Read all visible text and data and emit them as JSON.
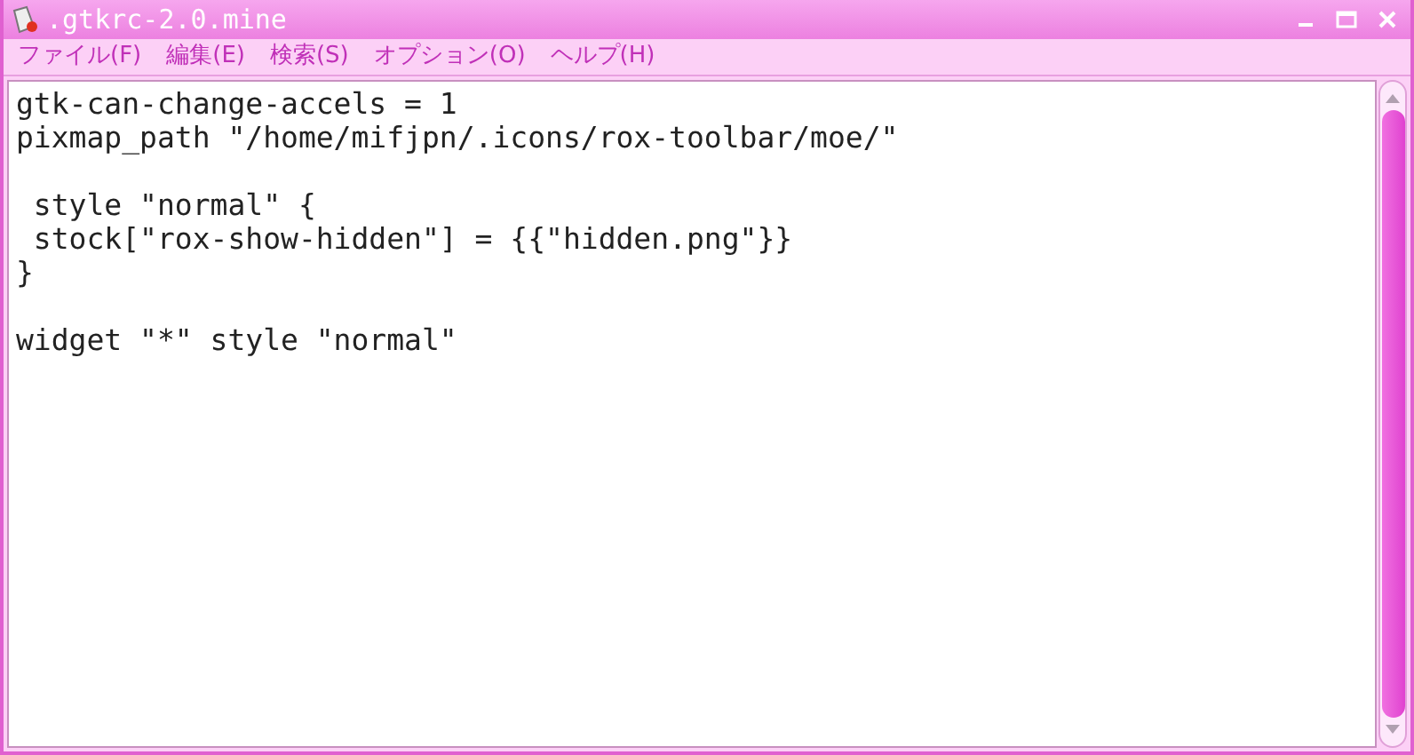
{
  "window": {
    "title": ".gtkrc-2.0.mine"
  },
  "menu": [
    "ファイル(F)",
    "編集(E)",
    "検索(S)",
    "オプション(O)",
    "ヘルプ(H)"
  ],
  "editor": {
    "lines": [
      {
        "kind": "text",
        "text": "gtk-can-change-accels = 1"
      },
      {
        "kind": "text",
        "text": "pixmap_path \"/home/mifjpn/.icons/rox-toolbar/moe/\""
      },
      {
        "kind": "blank"
      },
      {
        "kind": "text",
        "text": " style \"normal\" {"
      },
      {
        "kind": "text",
        "text": " stock[\"rox-show-hidden\"] = {{\"hidden.png\"}}"
      },
      {
        "kind": "text",
        "text": "}"
      },
      {
        "kind": "blank"
      },
      {
        "kind": "text",
        "text": "widget \"*\" style \"normal\""
      }
    ]
  }
}
